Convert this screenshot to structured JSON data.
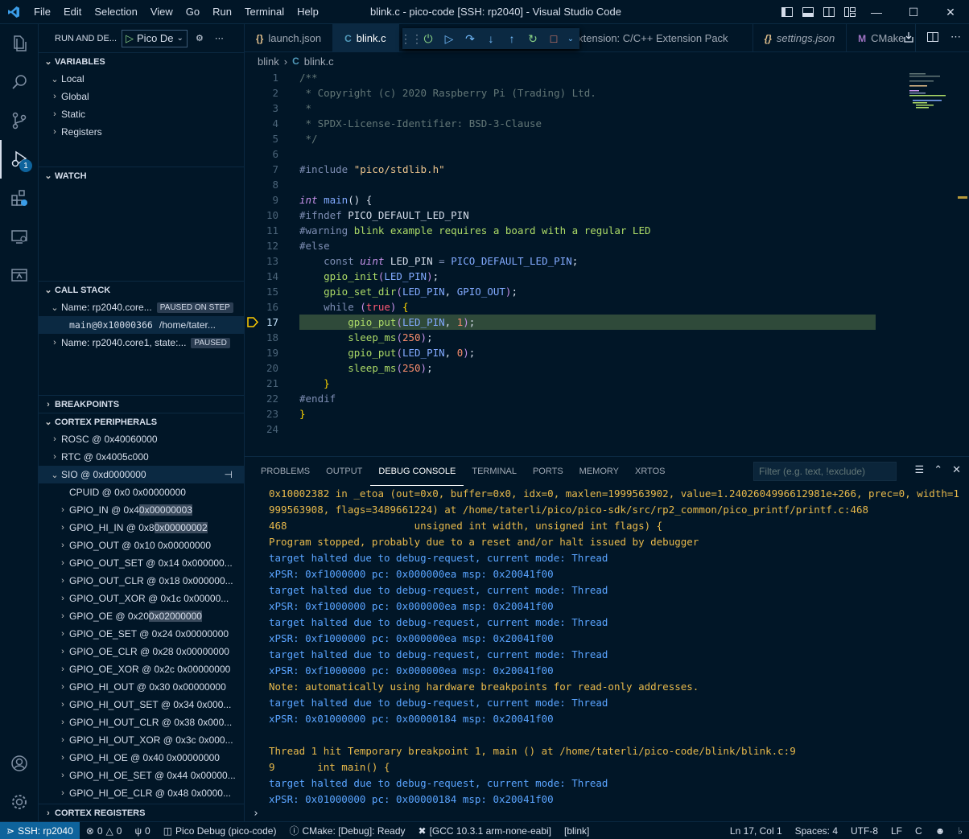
{
  "titlebar": {
    "menu": [
      "File",
      "Edit",
      "Selection",
      "View",
      "Go",
      "Run",
      "Terminal",
      "Help"
    ],
    "title": "blink.c - pico-code [SSH: rp2040] - Visual Studio Code"
  },
  "activity": {
    "debug_badge": "1"
  },
  "sidebar": {
    "header_title": "RUN AND DE...",
    "config_name": "Pico De",
    "variables_title": "VARIABLES",
    "variables": [
      "Local",
      "Global",
      "Static",
      "Registers"
    ],
    "watch_title": "WATCH",
    "callstack_title": "CALL STACK",
    "callstack": {
      "thread0": "Name: rp2040.core...",
      "thread0_status": "PAUSED ON STEP",
      "frame": "main@0x10000366",
      "frame_path": "/home/tater...",
      "thread1": "Name: rp2040.core1, state:...",
      "thread1_status": "PAUSED"
    },
    "breakpoints_title": "BREAKPOINTS",
    "cortex_title": "CORTEX PERIPHERALS",
    "peripherals": [
      {
        "label": "ROSC @ 0x40060000",
        "chev": "›",
        "indent": 1
      },
      {
        "label": "RTC @ 0x4005c000",
        "chev": "›",
        "indent": 1
      },
      {
        "label": "SIO @ 0xd0000000",
        "chev": "⌄",
        "indent": 1
      },
      {
        "label": "CPUID @ 0x0 0x00000000",
        "chev": "",
        "indent": 2
      },
      {
        "label": "GPIO_IN @ 0x4 ",
        "value": "0x00000003",
        "chev": "›",
        "indent": 2
      },
      {
        "label": "GPIO_HI_IN @ 0x8 ",
        "value": "0x00000002",
        "chev": "›",
        "indent": 2
      },
      {
        "label": "GPIO_OUT @ 0x10 0x00000000",
        "chev": "›",
        "indent": 2
      },
      {
        "label": "GPIO_OUT_SET @ 0x14 0x000000...",
        "chev": "›",
        "indent": 2
      },
      {
        "label": "GPIO_OUT_CLR @ 0x18 0x000000...",
        "chev": "›",
        "indent": 2
      },
      {
        "label": "GPIO_OUT_XOR @ 0x1c 0x00000...",
        "chev": "›",
        "indent": 2
      },
      {
        "label": "GPIO_OE @ 0x20 ",
        "value": "0x02000000",
        "chev": "›",
        "indent": 2
      },
      {
        "label": "GPIO_OE_SET @ 0x24 0x00000000",
        "chev": "›",
        "indent": 2
      },
      {
        "label": "GPIO_OE_CLR @ 0x28 0x00000000",
        "chev": "›",
        "indent": 2
      },
      {
        "label": "GPIO_OE_XOR @ 0x2c 0x00000000",
        "chev": "›",
        "indent": 2
      },
      {
        "label": "GPIO_HI_OUT @ 0x30 0x00000000",
        "chev": "›",
        "indent": 2
      },
      {
        "label": "GPIO_HI_OUT_SET @ 0x34 0x000...",
        "chev": "›",
        "indent": 2
      },
      {
        "label": "GPIO_HI_OUT_CLR @ 0x38 0x000...",
        "chev": "›",
        "indent": 2
      },
      {
        "label": "GPIO_HI_OUT_XOR @ 0x3c 0x000...",
        "chev": "›",
        "indent": 2
      },
      {
        "label": "GPIO_HI_OE @ 0x40 0x00000000",
        "chev": "›",
        "indent": 2
      },
      {
        "label": "GPIO_HI_OE_SET @ 0x44 0x00000...",
        "chev": "›",
        "indent": 2
      },
      {
        "label": "GPIO_HI_OE_CLR @ 0x48 0x0000...",
        "chev": "›",
        "indent": 2
      }
    ],
    "cortex_registers_title": "CORTEX REGISTERS"
  },
  "tabs": [
    {
      "label": "launch.json",
      "icon": "json",
      "active": false
    },
    {
      "label": "blink.c",
      "icon": "c",
      "active": true
    },
    {
      "label": "xtension: C/C++ Extension Pack",
      "icon": "",
      "active": false
    },
    {
      "label": "settings.json",
      "icon": "json",
      "active": false
    },
    {
      "label": "CMake",
      "icon": "cmake",
      "active": false
    }
  ],
  "breadcrumb": {
    "folder": "blink",
    "file": "blink.c"
  },
  "editor": {
    "current_line": 17,
    "lines": [
      {
        "n": "1",
        "html": "<span class='c-comment'>/**</span>"
      },
      {
        "n": "2",
        "html": "<span class='c-comment'> * Copyright (c) 2020 Raspberry Pi (Trading) Ltd.</span>"
      },
      {
        "n": "3",
        "html": "<span class='c-comment'> *</span>"
      },
      {
        "n": "4",
        "html": "<span class='c-comment'> * SPDX-License-Identifier: BSD-3-Clause</span>"
      },
      {
        "n": "5",
        "html": "<span class='c-comment'> */</span>"
      },
      {
        "n": "6",
        "html": ""
      },
      {
        "n": "7",
        "html": "<span class='c-pre'>#include</span> <span class='c-str'>\"pico/stdlib.h\"</span>"
      },
      {
        "n": "8",
        "html": ""
      },
      {
        "n": "9",
        "html": "<span class='c-kw'>int</span> <span class='c-fn'>main</span><span class='c-punc'>() {</span>"
      },
      {
        "n": "10",
        "html": "<span class='c-pre'>#ifndef</span> <span class='c-ident'>PICO_DEFAULT_LED_PIN</span>"
      },
      {
        "n": "11",
        "html": "<span class='c-pre'>#warning</span> <span class='c-macro'>blink example requires a board with a regular LED</span>"
      },
      {
        "n": "12",
        "html": "<span class='c-pre'>#else</span>"
      },
      {
        "n": "13",
        "html": "    <span class='c-pre'>const</span> <span class='c-kw'>uint</span> <span class='c-ident'>LED_PIN</span> <span class='c-pre'>=</span> <span class='c-fn'>PICO_DEFAULT_LED_PIN</span><span class='c-punc'>;</span>"
      },
      {
        "n": "14",
        "html": "    <span class='c-call'>gpio_init</span><span class='c-param'>(</span><span class='c-fn'>LED_PIN</span><span class='c-param'>)</span><span class='c-punc'>;</span>"
      },
      {
        "n": "15",
        "html": "    <span class='c-call'>gpio_set_dir</span><span class='c-param'>(</span><span class='c-fn'>LED_PIN</span><span class='c-punc'>,</span> <span class='c-fn'>GPIO_OUT</span><span class='c-param'>)</span><span class='c-punc'>;</span>"
      },
      {
        "n": "16",
        "html": "    <span class='c-pre'>while</span> <span class='c-param'>(</span><span class='c-bool'>true</span><span class='c-param'>)</span> <span class='c-brk'>{</span>"
      },
      {
        "n": "17",
        "html": "        <span class='c-call'>gpio_put</span><span class='c-param'>(</span><span class='c-fn'>LED_PIN</span><span class='c-punc'>,</span> <span class='c-num'>1</span><span class='c-param'>)</span><span class='c-punc'>;</span>"
      },
      {
        "n": "18",
        "html": "        <span class='c-call'>sleep_ms</span><span class='c-param'>(</span><span class='c-num'>250</span><span class='c-param'>)</span><span class='c-punc'>;</span>"
      },
      {
        "n": "19",
        "html": "        <span class='c-call'>gpio_put</span><span class='c-param'>(</span><span class='c-fn'>LED_PIN</span><span class='c-punc'>,</span> <span class='c-num'>0</span><span class='c-param'>)</span><span class='c-punc'>;</span>"
      },
      {
        "n": "20",
        "html": "        <span class='c-call'>sleep_ms</span><span class='c-param'>(</span><span class='c-num'>250</span><span class='c-param'>)</span><span class='c-punc'>;</span>"
      },
      {
        "n": "21",
        "html": "    <span class='c-brk'>}</span>"
      },
      {
        "n": "22",
        "html": "<span class='c-pre'>#endif</span>"
      },
      {
        "n": "23",
        "html": "<span class='c-brk'>}</span>"
      },
      {
        "n": "24",
        "html": ""
      }
    ]
  },
  "panel": {
    "tabs": [
      "PROBLEMS",
      "OUTPUT",
      "DEBUG CONSOLE",
      "TERMINAL",
      "PORTS",
      "MEMORY",
      "XRTOS"
    ],
    "active_tab": "DEBUG CONSOLE",
    "filter_placeholder": "Filter (e.g. text, !exclude)",
    "console": [
      {
        "c": "y",
        "t": "0x10002382 in _etoa (out=0x0, buffer=0x0, idx=0, maxlen=1999563902, value=1.2402604996612981e+266, prec=0, width=1999563908, flags=3489661224) at /home/taterli/pico/pico-sdk/src/rp2_common/pico_printf/printf.c:468"
      },
      {
        "c": "y",
        "t": "468                     unsigned int width, unsigned int flags) {"
      },
      {
        "c": "y",
        "t": "Program stopped, probably due to a reset and/or halt issued by debugger"
      },
      {
        "c": "b",
        "t": "target halted due to debug-request, current mode: Thread"
      },
      {
        "c": "b",
        "t": "xPSR: 0xf1000000 pc: 0x000000ea msp: 0x20041f00"
      },
      {
        "c": "b",
        "t": "target halted due to debug-request, current mode: Thread"
      },
      {
        "c": "b",
        "t": "xPSR: 0xf1000000 pc: 0x000000ea msp: 0x20041f00"
      },
      {
        "c": "b",
        "t": "target halted due to debug-request, current mode: Thread"
      },
      {
        "c": "b",
        "t": "xPSR: 0xf1000000 pc: 0x000000ea msp: 0x20041f00"
      },
      {
        "c": "b",
        "t": "target halted due to debug-request, current mode: Thread"
      },
      {
        "c": "b",
        "t": "xPSR: 0xf1000000 pc: 0x000000ea msp: 0x20041f00"
      },
      {
        "c": "y",
        "t": "Note: automatically using hardware breakpoints for read-only addresses."
      },
      {
        "c": "b",
        "t": "target halted due to debug-request, current mode: Thread"
      },
      {
        "c": "b",
        "t": "xPSR: 0x01000000 pc: 0x00000184 msp: 0x20041f00"
      },
      {
        "c": "w",
        "t": " "
      },
      {
        "c": "y",
        "t": "Thread 1 hit Temporary breakpoint 1, main () at /home/taterli/pico-code/blink/blink.c:9"
      },
      {
        "c": "y",
        "t": "9       int main() {"
      },
      {
        "c": "b",
        "t": "target halted due to debug-request, current mode: Thread"
      },
      {
        "c": "b",
        "t": "xPSR: 0x01000000 pc: 0x00000184 msp: 0x20041f00"
      }
    ],
    "prompt": "›"
  },
  "statusbar": {
    "remote": "SSH: rp2040",
    "errors": "0",
    "warnings": "0",
    "ports": "0",
    "debug": "Pico Debug (pico-code)",
    "cmake": "CMake: [Debug]: Ready",
    "kit": "[GCC 10.3.1 arm-none-eabi]",
    "target": "[blink]",
    "position": "Ln 17, Col 1",
    "spaces": "Spaces: 4",
    "encoding": "UTF-8",
    "eol": "LF",
    "language": "C"
  }
}
